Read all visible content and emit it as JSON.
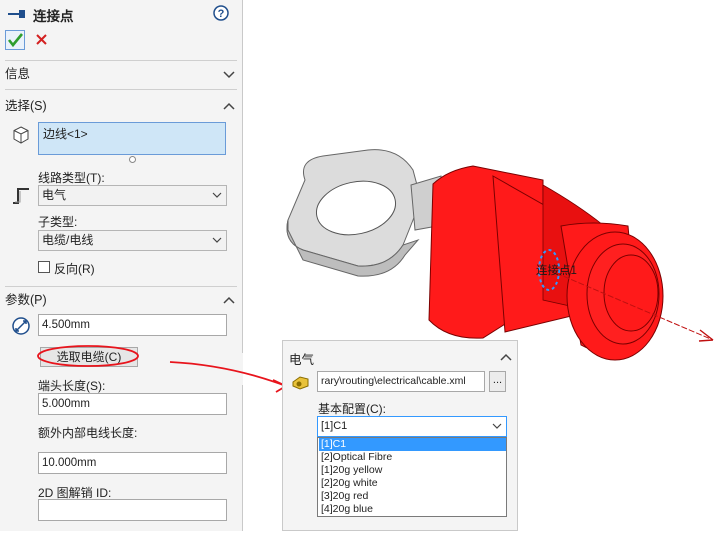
{
  "panel": {
    "title": "连接点",
    "confirm_icon": "check-icon",
    "cancel_icon": "close-icon",
    "sections": {
      "info": {
        "label": "信息"
      },
      "selection": {
        "label": "选择(S)"
      },
      "params": {
        "label": "参数(P)"
      }
    },
    "selection_box": {
      "value": "边线<1>"
    },
    "route_type": {
      "label": "线路类型(T):",
      "value": "电气"
    },
    "sub_type": {
      "label": "子类型:",
      "value": "电缆/电线"
    },
    "reverse": {
      "label": "反向(R)",
      "checked": false
    },
    "diameter": {
      "value": "4.500mm"
    },
    "select_cable_button": "选取电缆(C)",
    "end_length": {
      "label": "端头长度(S):",
      "value": "5.000mm"
    },
    "extra_internal_length": {
      "label": "额外内部电线长度:",
      "value": "10.000mm"
    },
    "pin_2d": {
      "label": "2D 图解销 ID:",
      "value": ""
    }
  },
  "popup": {
    "title": "电气",
    "library_path": "rary\\routing\\electrical\\cable.xml",
    "browse_button": "...",
    "base_config_label": "基本配置(C):",
    "base_config_value": "[1]C1",
    "options": [
      "[1]C1",
      "[2]Optical Fibre",
      "[1]20g yellow",
      "[2]20g white",
      "[3]20g red",
      "[4]20g blue"
    ],
    "selected_index": 0
  },
  "viewport": {
    "label_text": "连接点1"
  },
  "colors": {
    "terminal_red": "#ff1a1a",
    "ring_gray": "#dcdcdc",
    "selection_blue": "#cfe6f7",
    "highlight_blue": "#3399ff",
    "annotation_red": "#e8141c",
    "confirm_green": "#2e9e2e"
  }
}
